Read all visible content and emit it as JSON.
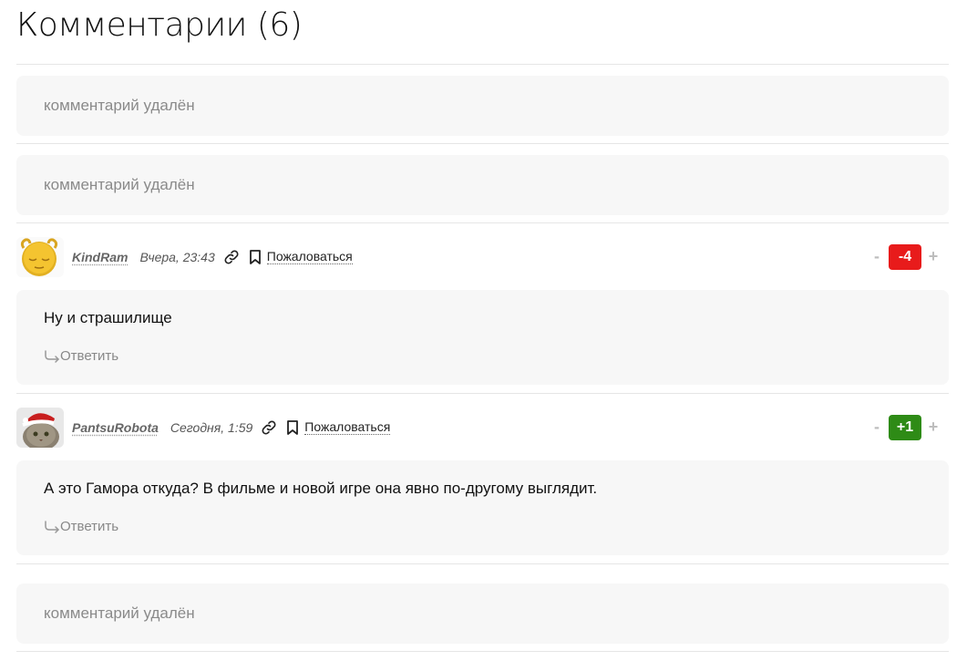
{
  "header": {
    "title": "Комментарии (6)"
  },
  "deleted_label": "комментарий удалён",
  "comments": [
    {
      "author": "KindRam",
      "date": "Вчера, 23:43",
      "complain_label": "Пожаловаться",
      "text": "Ну и страшилище",
      "reply_label": "Ответить",
      "score": "-4",
      "vote_minus": "-",
      "vote_plus": "+",
      "score_color": "#e81b1b"
    },
    {
      "author": "PantsuRobota",
      "date": "Сегодня, 1:59",
      "complain_label": "Пожаловаться",
      "text": "А это Гамора откуда? В фильме и новой игре она явно по-другому выглядит.",
      "reply_label": "Ответить",
      "score": "+1",
      "vote_minus": "-",
      "vote_plus": "+",
      "score_color": "#2e8b16"
    }
  ],
  "icons": {
    "link": "link-icon",
    "flag": "bookmark-flag-icon",
    "reply": "reply-arrow-icon"
  }
}
